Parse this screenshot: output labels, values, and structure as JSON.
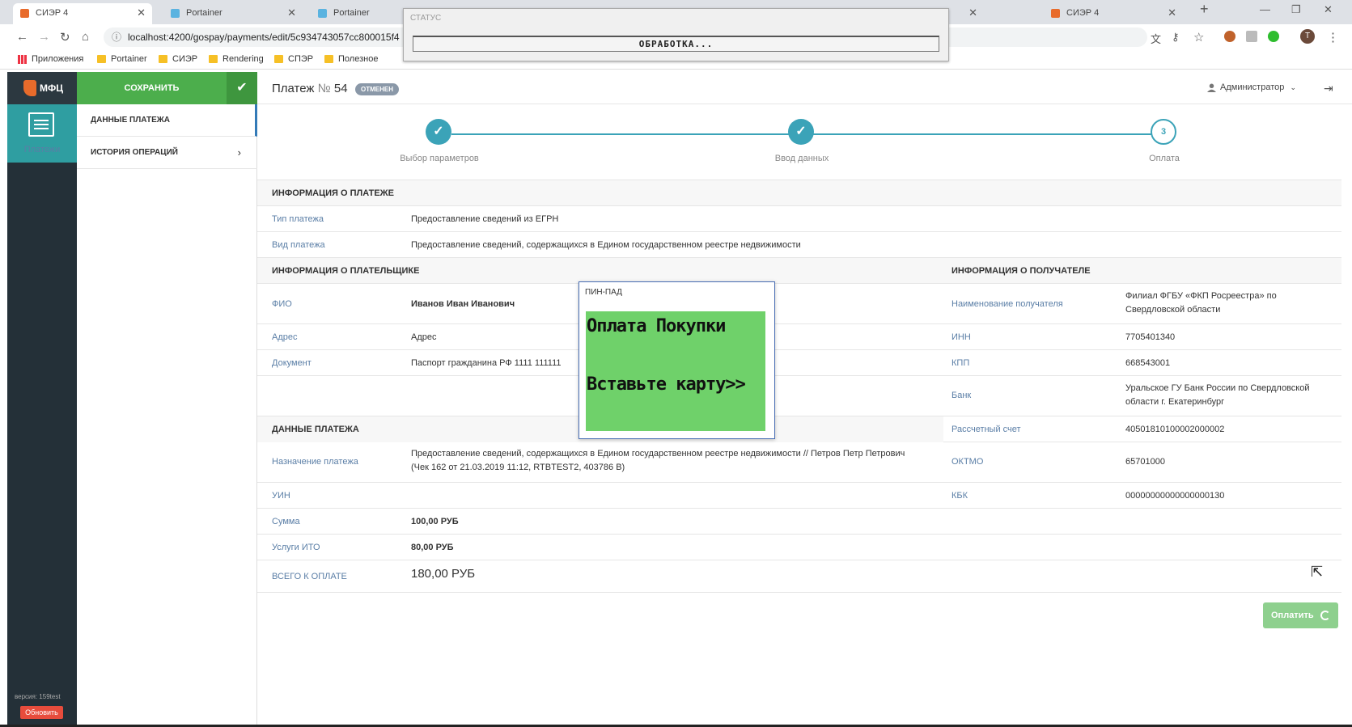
{
  "browser": {
    "tabs": [
      {
        "title": "СИЭР 4",
        "active": true
      },
      {
        "title": "Portainer",
        "active": false
      },
      {
        "title": "Portainer",
        "active": false
      },
      {
        "title": "СИЭР 4",
        "active": false
      }
    ],
    "url": "localhost:4200/gospay/payments/edit/5c934743057cc800015f4",
    "bookmarks": [
      "Приложения",
      "Portainer",
      "СИЭР",
      "Rendering",
      "СПЭР",
      "Полезное"
    ],
    "profile_initial": "T"
  },
  "status_dialog": {
    "title": "СТАТУС",
    "message": "ОБРАБОТКА..."
  },
  "pinpad": {
    "title": "ПИН-ПАД",
    "line1": "Оплата Покупки",
    "line2": "Вставьте карту>>",
    "screen_color": "#6fd16a"
  },
  "sidebar": {
    "logo": "МФЦ",
    "module": "Платежи",
    "version": "версия: 159test",
    "refresh": "Обновить"
  },
  "toolbar": {
    "save": "СОХРАНИТЬ"
  },
  "subnav": {
    "items": [
      "ДАННЫЕ ПЛАТЕЖА",
      "ИСТОРИЯ ОПЕРАЦИЙ"
    ]
  },
  "header": {
    "title": "Платеж",
    "number_sign": "№",
    "number": "54",
    "badge": "ОТМЕНЕН",
    "user": "Администратор"
  },
  "steps": [
    {
      "label": "Выбор параметров",
      "state": "done"
    },
    {
      "label": "Ввод данных",
      "state": "done"
    },
    {
      "label": "Оплата",
      "number": "3",
      "state": "current"
    }
  ],
  "payment_info": {
    "section": "ИНФОРМАЦИЯ О ПЛАТЕЖЕ",
    "type_label": "Тип платежа",
    "type_value": "Предоставление сведений из ЕГРН",
    "kind_label": "Вид платежа",
    "kind_value": "Предоставление сведений, содержащихся в Едином государственном реестре недвижимости"
  },
  "payer": {
    "section": "ИНФОРМАЦИЯ О ПЛАТЕЛЬЩИКЕ",
    "fio_label": "ФИО",
    "fio": "Иванов Иван Иванович",
    "address_label": "Адрес",
    "address": "Адрес",
    "doc_label": "Документ",
    "doc": "Паспорт гражданина РФ 1111 111111"
  },
  "recipient": {
    "section": "ИНФОРМАЦИЯ О ПОЛУЧАТЕЛЕ",
    "name_label": "Наименование получателя",
    "name_line1": "Филиал ФГБУ «ФКП Росреестра» по",
    "name_line2": "Свердловской области",
    "inn_label": "ИНН",
    "inn": "7705401340",
    "kpp_label": "КПП",
    "kpp": "668543001",
    "bank_label": "Банк",
    "bank_line1": "Уральское ГУ Банк России по Свердловской",
    "bank_line2": "области г. Екатеринбург",
    "account_label": "Рассчетный счет",
    "account": "40501810100002000002",
    "oktmo_label": "ОКТМО",
    "oktmo": "65701000",
    "kbk_label": "КБК",
    "kbk": "00000000000000000130"
  },
  "payment_data": {
    "section": "ДАННЫЕ ПЛАТЕЖА",
    "purpose_label": "Назначение платежа",
    "purpose_line1": "Предоставление сведений, содержащихся в Едином государственном реестре недвижимости // Петров Петр Петрович",
    "purpose_line2": "(Чек 162 от 21.03.2019 11:12, RTBTEST2, 403786 В)",
    "uin_label": "УИН",
    "sum_label": "Сумма",
    "sum": "100,00 РУБ",
    "ito_label": "Услуги ИТО",
    "ito": "80,00 РУБ",
    "total_label": "ВСЕГО К ОПЛАТЕ",
    "total": "180,00 РУБ"
  },
  "pay_button": "Оплатить",
  "colors": {
    "accent": "#3ba3b8",
    "save": "#4cae4c",
    "sidebar": "#243038",
    "label": "#5a7ea6",
    "danger": "#e74c3c"
  }
}
